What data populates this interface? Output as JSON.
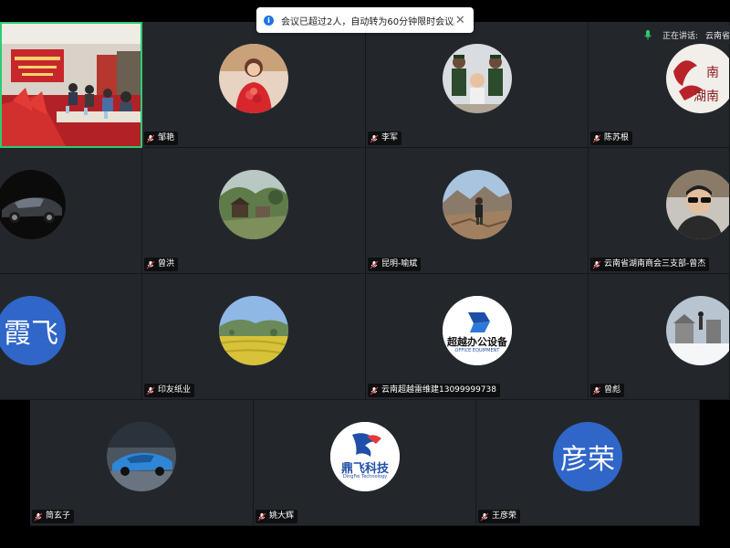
{
  "toast": {
    "text": "会议已超过2人，自动转为60分钟限时会议。",
    "info_icon": "i",
    "close_icon": "✕"
  },
  "speaking": {
    "label": "正在讲话:",
    "name": "云南省"
  },
  "participants": [
    {
      "name": "",
      "avatar": "video"
    },
    {
      "name": "邹艳",
      "avatar": "photo-woman-flowers"
    },
    {
      "name": "李军",
      "avatar": "photo-soldiers-child"
    },
    {
      "name": "陈苏根",
      "avatar": "logo-hunan"
    },
    {
      "name": "",
      "avatar": "photo-car"
    },
    {
      "name": "曾洪",
      "avatar": "photo-village"
    },
    {
      "name": "昆明-喻斌",
      "avatar": "photo-mountain-man"
    },
    {
      "name": "云南省湖南商会三支部-曾杰",
      "avatar": "photo-man-sunglasses"
    },
    {
      "name": "",
      "avatar_text": "霞飞"
    },
    {
      "name": "印友纸业",
      "avatar": "photo-rapeseed-field"
    },
    {
      "name": "云南超越雷维建13099999738",
      "avatar": "logo-chaoyue",
      "logo_text": "超越办公设备",
      "logo_subtext": "OFFICE EQUIPMENT"
    },
    {
      "name": "曾彪",
      "avatar": "photo-snow-village"
    },
    {
      "name": "简玄子",
      "avatar": "photo-bugatti"
    },
    {
      "name": "姚大辉",
      "avatar": "logo-dingfei",
      "logo_text": "鼎飞科技",
      "logo_subtext": "DingFei Technology"
    },
    {
      "name": "王彦荣",
      "avatar_text": "彦荣"
    }
  ],
  "colors": {
    "tile_bg": "#23272c",
    "active_border": "#2ecc71",
    "text_avatar": "#2f66c8",
    "accent_blue": "#1e74e8"
  }
}
